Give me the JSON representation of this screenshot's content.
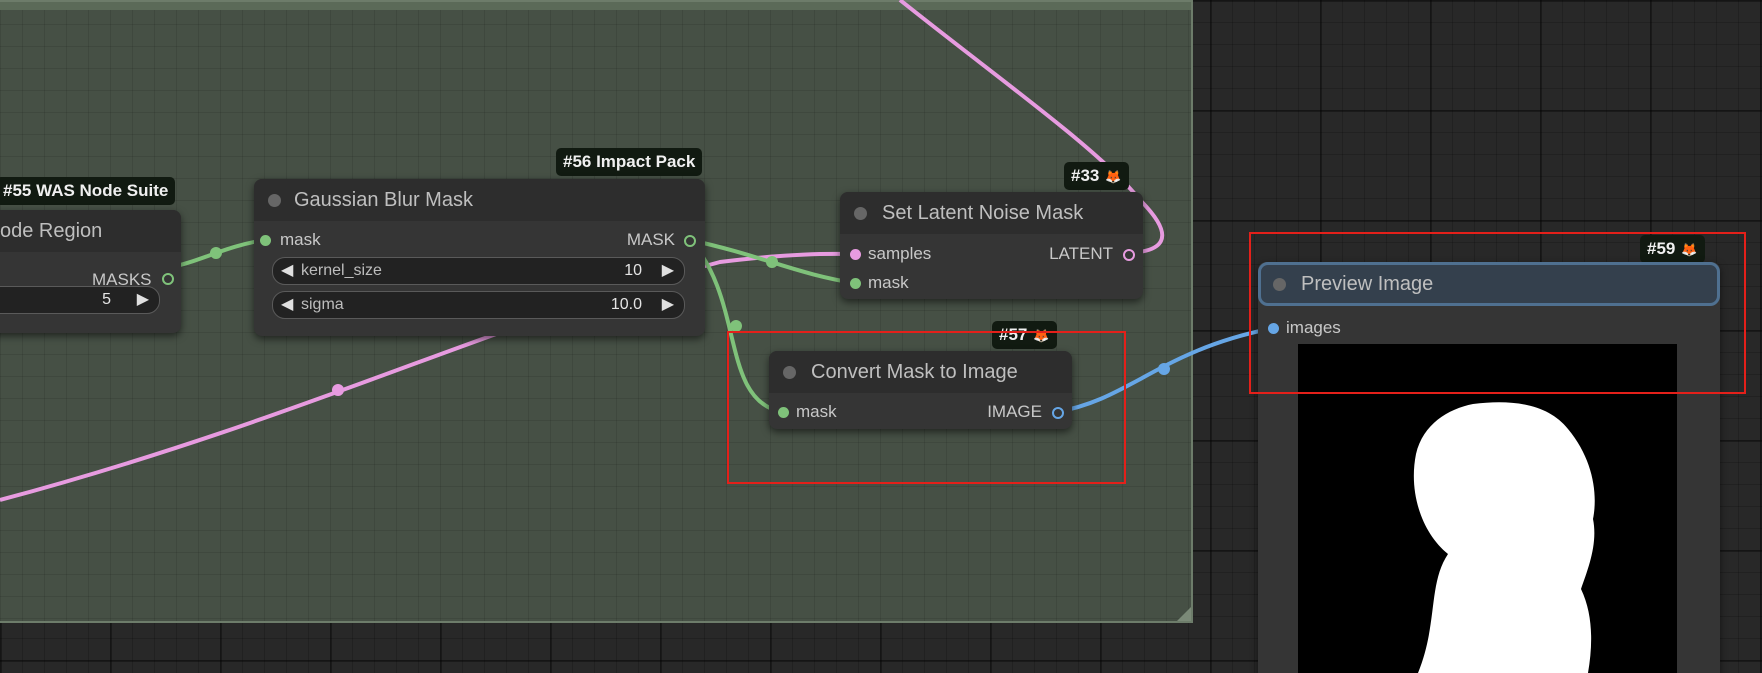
{
  "group": {
    "name": "group-frame"
  },
  "nodes": {
    "was_region": {
      "badge": "#55 WAS Node Suite",
      "title": "ode Region",
      "output_label": "MASKS",
      "widget_value": "5"
    },
    "gaussian_blur": {
      "badge": "#56 Impact Pack",
      "title": "Gaussian Blur Mask",
      "input_label": "mask",
      "output_label": "MASK",
      "widgets": [
        {
          "name": "kernel_size",
          "value": "10"
        },
        {
          "name": "sigma",
          "value": "10.0"
        }
      ]
    },
    "set_latent": {
      "badge": "#33",
      "title": "Set Latent Noise Mask",
      "inputs": [
        "samples",
        "mask"
      ],
      "output_label": "LATENT"
    },
    "convert_mask": {
      "badge": "#57",
      "title": "Convert Mask to Image",
      "input_label": "mask",
      "output_label": "IMAGE"
    },
    "preview": {
      "badge": "#59",
      "title": "Preview Image",
      "input_label": "images"
    }
  },
  "icons": {
    "badge_icon": "fox-icon",
    "fox_glyph": "🦊"
  },
  "colors": {
    "mask_link": "#7fc27a",
    "latent_link": "#e79be0",
    "image_link": "#66a6e6",
    "highlight": "#e4201a",
    "group_bg": "#465045"
  }
}
